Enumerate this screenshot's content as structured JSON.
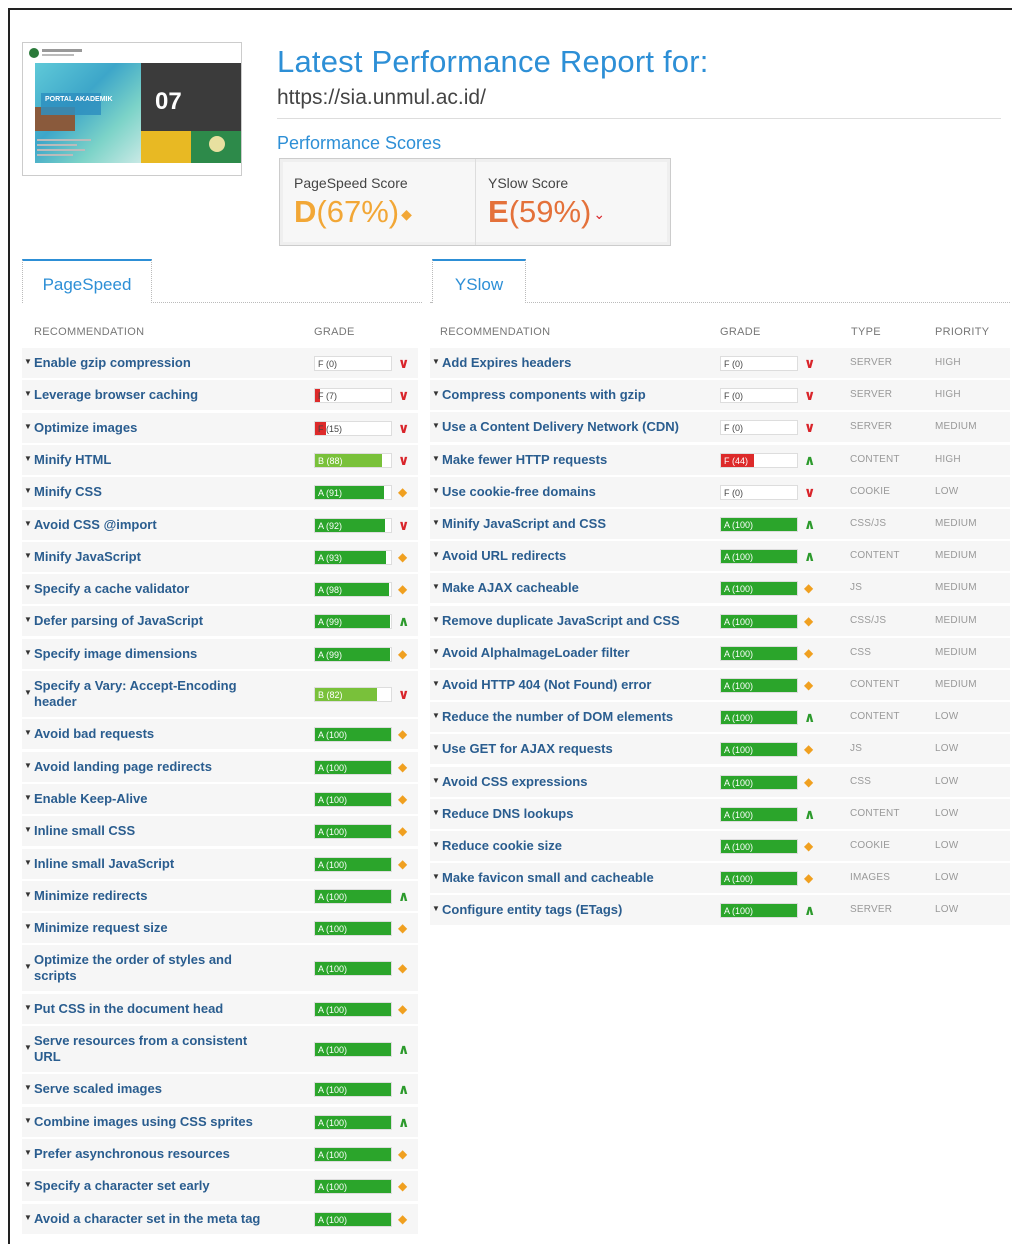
{
  "header": {
    "title": "Latest Performance Report for:",
    "url": "https://sia.unmul.ac.id/",
    "scores_title": "Performance Scores",
    "thumbnail": {
      "banner_text": "PORTAL AKADEMIK",
      "date_text": "07"
    },
    "pagespeed": {
      "label": "PageSpeed Score",
      "grade": "D",
      "percent": "(67%)",
      "icon": "diamond-icon",
      "color": "#f2a736"
    },
    "yslow": {
      "label": "YSlow Score",
      "grade": "E",
      "percent": "(59%)",
      "icon": "chevron-down-icon",
      "color": "#e4713a"
    }
  },
  "tabs": {
    "pagespeed": "PageSpeed",
    "yslow": "YSlow"
  },
  "pagespeed_table": {
    "headers": {
      "recommendation": "RECOMMENDATION",
      "grade": "GRADE"
    },
    "rows": [
      {
        "name": "Enable gzip compression",
        "grade": "F (0)",
        "score": 0,
        "trend": "down"
      },
      {
        "name": "Leverage browser caching",
        "grade": "F (7)",
        "score": 7,
        "trend": "down"
      },
      {
        "name": "Optimize images",
        "grade": "F (15)",
        "score": 15,
        "trend": "down"
      },
      {
        "name": "Minify HTML",
        "grade": "B (88)",
        "score": 88,
        "trend": "down"
      },
      {
        "name": "Minify CSS",
        "grade": "A (91)",
        "score": 91,
        "trend": "same"
      },
      {
        "name": "Avoid CSS @import",
        "grade": "A (92)",
        "score": 92,
        "trend": "down"
      },
      {
        "name": "Minify JavaScript",
        "grade": "A (93)",
        "score": 93,
        "trend": "same"
      },
      {
        "name": "Specify a cache validator",
        "grade": "A (98)",
        "score": 98,
        "trend": "same"
      },
      {
        "name": "Defer parsing of JavaScript",
        "grade": "A (99)",
        "score": 99,
        "trend": "up"
      },
      {
        "name": "Specify image dimensions",
        "grade": "A (99)",
        "score": 99,
        "trend": "same"
      },
      {
        "name": "Specify a Vary: Accept-Encoding header",
        "grade": "B (82)",
        "score": 82,
        "trend": "down"
      },
      {
        "name": "Avoid bad requests",
        "grade": "A (100)",
        "score": 100,
        "trend": "same"
      },
      {
        "name": "Avoid landing page redirects",
        "grade": "A (100)",
        "score": 100,
        "trend": "same"
      },
      {
        "name": "Enable Keep-Alive",
        "grade": "A (100)",
        "score": 100,
        "trend": "same"
      },
      {
        "name": "Inline small CSS",
        "grade": "A (100)",
        "score": 100,
        "trend": "same"
      },
      {
        "name": "Inline small JavaScript",
        "grade": "A (100)",
        "score": 100,
        "trend": "same"
      },
      {
        "name": "Minimize redirects",
        "grade": "A (100)",
        "score": 100,
        "trend": "up"
      },
      {
        "name": "Minimize request size",
        "grade": "A (100)",
        "score": 100,
        "trend": "same"
      },
      {
        "name": "Optimize the order of styles and scripts",
        "grade": "A (100)",
        "score": 100,
        "trend": "same"
      },
      {
        "name": "Put CSS in the document head",
        "grade": "A (100)",
        "score": 100,
        "trend": "same"
      },
      {
        "name": "Serve resources from a consistent URL",
        "grade": "A (100)",
        "score": 100,
        "trend": "up"
      },
      {
        "name": "Serve scaled images",
        "grade": "A (100)",
        "score": 100,
        "trend": "up"
      },
      {
        "name": "Combine images using CSS sprites",
        "grade": "A (100)",
        "score": 100,
        "trend": "up"
      },
      {
        "name": "Prefer asynchronous resources",
        "grade": "A (100)",
        "score": 100,
        "trend": "same"
      },
      {
        "name": "Specify a character set early",
        "grade": "A (100)",
        "score": 100,
        "trend": "same"
      },
      {
        "name": "Avoid a character set in the meta tag",
        "grade": "A (100)",
        "score": 100,
        "trend": "same"
      }
    ]
  },
  "yslow_table": {
    "headers": {
      "recommendation": "RECOMMENDATION",
      "grade": "GRADE",
      "type": "TYPE",
      "priority": "PRIORITY"
    },
    "rows": [
      {
        "name": "Add Expires headers",
        "grade": "F (0)",
        "score": 0,
        "trend": "down",
        "type": "SERVER",
        "priority": "HIGH"
      },
      {
        "name": "Compress components with gzip",
        "grade": "F (0)",
        "score": 0,
        "trend": "down",
        "type": "SERVER",
        "priority": "HIGH"
      },
      {
        "name": "Use a Content Delivery Network (CDN)",
        "grade": "F (0)",
        "score": 0,
        "trend": "down",
        "type": "SERVER",
        "priority": "MEDIUM"
      },
      {
        "name": "Make fewer HTTP requests",
        "grade": "F (44)",
        "score": 44,
        "trend": "up",
        "type": "CONTENT",
        "priority": "HIGH"
      },
      {
        "name": "Use cookie-free domains",
        "grade": "F (0)",
        "score": 0,
        "trend": "down",
        "type": "COOKIE",
        "priority": "LOW"
      },
      {
        "name": "Minify JavaScript and CSS",
        "grade": "A (100)",
        "score": 100,
        "trend": "up",
        "type": "CSS/JS",
        "priority": "MEDIUM"
      },
      {
        "name": "Avoid URL redirects",
        "grade": "A (100)",
        "score": 100,
        "trend": "up",
        "type": "CONTENT",
        "priority": "MEDIUM"
      },
      {
        "name": "Make AJAX cacheable",
        "grade": "A (100)",
        "score": 100,
        "trend": "same",
        "type": "JS",
        "priority": "MEDIUM"
      },
      {
        "name": "Remove duplicate JavaScript and CSS",
        "grade": "A (100)",
        "score": 100,
        "trend": "same",
        "type": "CSS/JS",
        "priority": "MEDIUM"
      },
      {
        "name": "Avoid AlphaImageLoader filter",
        "grade": "A (100)",
        "score": 100,
        "trend": "same",
        "type": "CSS",
        "priority": "MEDIUM"
      },
      {
        "name": "Avoid HTTP 404 (Not Found) error",
        "grade": "A (100)",
        "score": 100,
        "trend": "same",
        "type": "CONTENT",
        "priority": "MEDIUM"
      },
      {
        "name": "Reduce the number of DOM elements",
        "grade": "A (100)",
        "score": 100,
        "trend": "up",
        "type": "CONTENT",
        "priority": "LOW"
      },
      {
        "name": "Use GET for AJAX requests",
        "grade": "A (100)",
        "score": 100,
        "trend": "same",
        "type": "JS",
        "priority": "LOW"
      },
      {
        "name": "Avoid CSS expressions",
        "grade": "A (100)",
        "score": 100,
        "trend": "same",
        "type": "CSS",
        "priority": "LOW"
      },
      {
        "name": "Reduce DNS lookups",
        "grade": "A (100)",
        "score": 100,
        "trend": "up",
        "type": "CONTENT",
        "priority": "LOW"
      },
      {
        "name": "Reduce cookie size",
        "grade": "A (100)",
        "score": 100,
        "trend": "same",
        "type": "COOKIE",
        "priority": "LOW"
      },
      {
        "name": "Make favicon small and cacheable",
        "grade": "A (100)",
        "score": 100,
        "trend": "same",
        "type": "IMAGES",
        "priority": "LOW"
      },
      {
        "name": "Configure entity tags (ETags)",
        "grade": "A (100)",
        "score": 100,
        "trend": "up",
        "type": "SERVER",
        "priority": "LOW"
      }
    ]
  },
  "colors": {
    "grade_a": "#2ba52b",
    "grade_b": "#79c13a",
    "grade_f": "#dd2a2a",
    "link_blue": "#2d8fd6"
  },
  "icons": {
    "down": "chevron-down-icon",
    "up": "chevron-up-icon",
    "same": "diamond-icon"
  }
}
